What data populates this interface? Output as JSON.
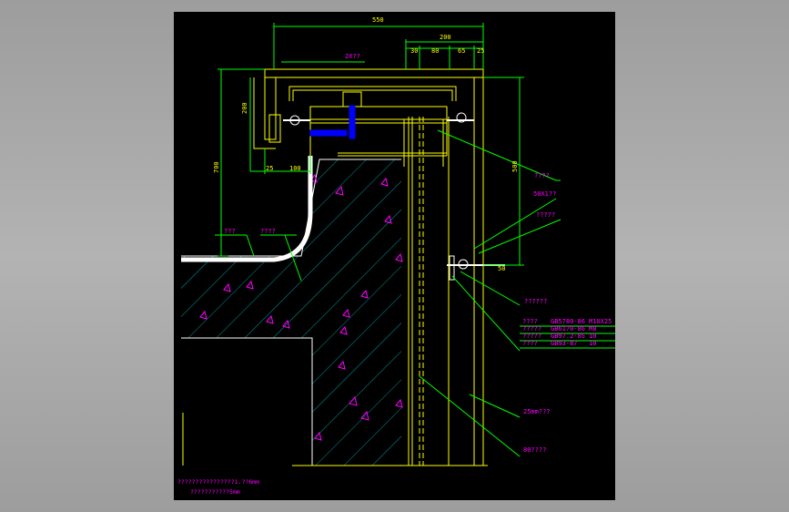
{
  "colors": {
    "background": "#000000",
    "frame": "#a5a5a5",
    "dimension": "#00ff00",
    "structure": "#ffff00",
    "hatch": "#00c0c0",
    "text": "#ff00ff",
    "steel": "#ffffff",
    "bolt": "#0000ff"
  },
  "dimensions": {
    "overall_width": "550",
    "upper_width": "200",
    "seg_30": "30",
    "seg_80": "80",
    "seg_65": "65",
    "seg_25": "25",
    "left_height_200": "200",
    "left_height_700": "700",
    "bottom_25": "25",
    "bottom_100": "100",
    "right_height_500": "500",
    "small_50": "50"
  },
  "labels": {
    "top_label": "2X??",
    "wall_label_1": "????",
    "wall_label_2": "???",
    "wall_label_3": "????",
    "callout_1": "????",
    "callout_2": "50X1??",
    "callout_3": "?????",
    "callout_4": "??????",
    "callout_5": "25mm???",
    "callout_6": "80????"
  },
  "spec_table": [
    {
      "name": "????",
      "spec": "GB5780-86",
      "size": "M10X25"
    },
    {
      "name": "?????",
      "spec": "GB6170-86",
      "size": "M8"
    },
    {
      "name": "?????",
      "spec": "GB97.2-85",
      "size": "10"
    },
    {
      "name": "????",
      "spec": "GB93-87",
      "size": "10"
    }
  ],
  "notes": {
    "line_1": "????????????????1.??6mm",
    "line_2": "???????????5mm"
  }
}
